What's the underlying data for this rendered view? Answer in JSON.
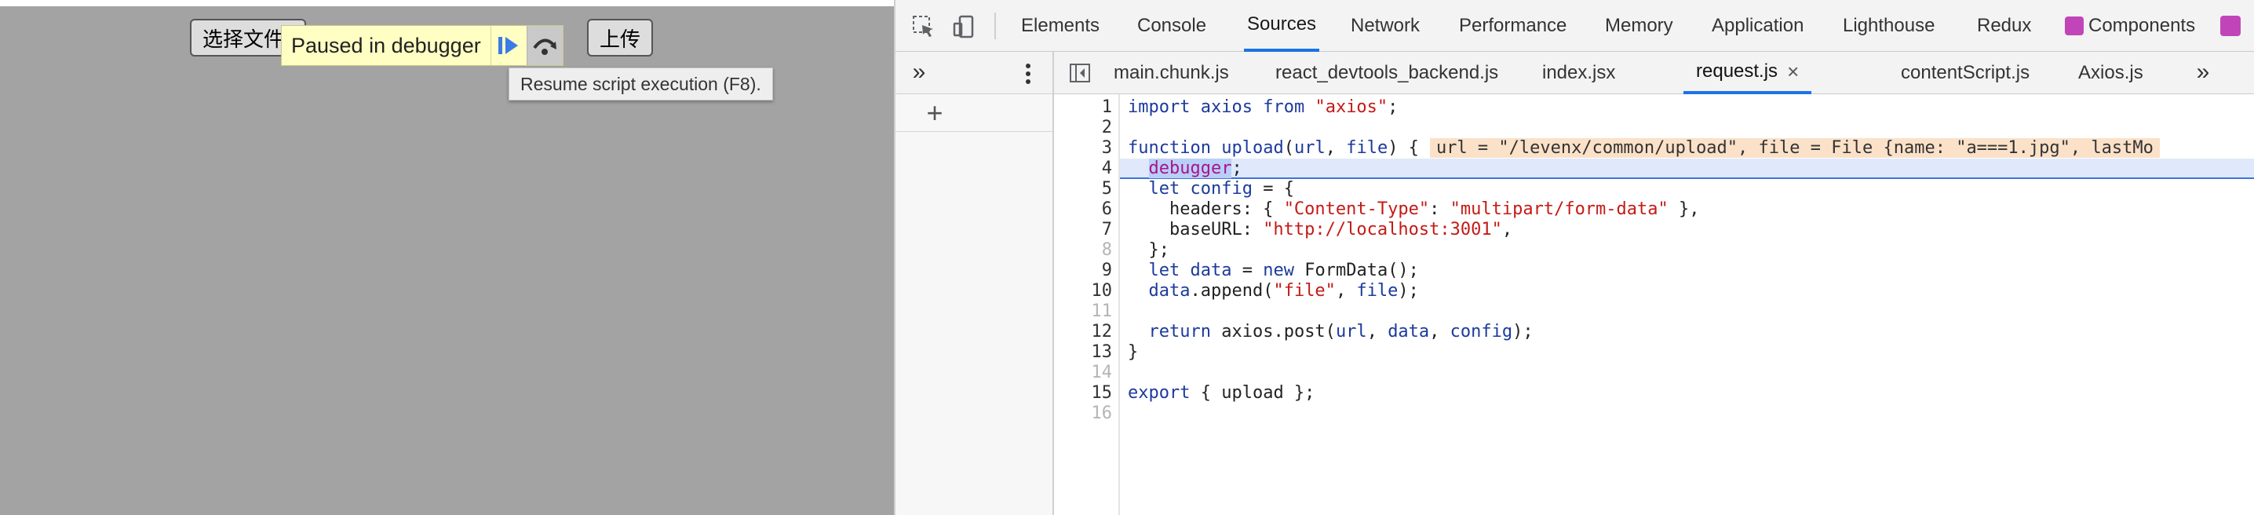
{
  "page": {
    "file_button_label": "选择文件",
    "upload_button_label": "上传",
    "paused_label": "Paused in debugger",
    "tooltip": "Resume script execution (F8)."
  },
  "devtools": {
    "main_tabs": [
      "Elements",
      "Console",
      "Sources",
      "Network",
      "Performance",
      "Memory",
      "Application",
      "Lighthouse",
      "Redux",
      "Components"
    ],
    "active_main_tab": "Sources",
    "file_tabs": [
      "main.chunk.js",
      "react_devtools_backend.js",
      "index.jsx",
      "request.js",
      "contentScript.js",
      "Axios.js"
    ],
    "active_file_tab": "request.js",
    "close_glyph": "×",
    "more_glyph": "»",
    "add_glyph": "+",
    "paused_line": 4,
    "code_lines": [
      {
        "n": "1",
        "tokens": [
          [
            "kw2",
            "import"
          ],
          [
            "plain",
            " "
          ],
          [
            "var",
            "axios"
          ],
          [
            "plain",
            " "
          ],
          [
            "kw2",
            "from"
          ],
          [
            "plain",
            " "
          ],
          [
            "str",
            "\"axios\""
          ],
          [
            "plain",
            ";"
          ]
        ]
      },
      {
        "n": "2",
        "tokens": []
      },
      {
        "n": "3",
        "tokens": [
          [
            "kw2",
            "function"
          ],
          [
            "plain",
            " "
          ],
          [
            "var",
            "upload"
          ],
          [
            "plain",
            "("
          ],
          [
            "var",
            "url"
          ],
          [
            "plain",
            ", "
          ],
          [
            "var",
            "file"
          ],
          [
            "plain",
            ") {"
          ]
        ],
        "inline": "url = \"/levenx/common/upload\", file = File {name: \"a===1.jpg\", lastMo"
      },
      {
        "n": "4",
        "tokens": [
          [
            "plain",
            "  "
          ],
          [
            "kw",
            "debugger"
          ],
          [
            "plain",
            ";"
          ]
        ]
      },
      {
        "n": "5",
        "tokens": [
          [
            "plain",
            "  "
          ],
          [
            "kw2",
            "let"
          ],
          [
            "plain",
            " "
          ],
          [
            "var",
            "config"
          ],
          [
            "plain",
            " = {"
          ]
        ]
      },
      {
        "n": "6",
        "tokens": [
          [
            "plain",
            "    headers: { "
          ],
          [
            "str",
            "\"Content-Type\""
          ],
          [
            "plain",
            ": "
          ],
          [
            "str",
            "\"multipart/form-data\""
          ],
          [
            "plain",
            " },"
          ]
        ]
      },
      {
        "n": "7",
        "tokens": [
          [
            "plain",
            "    baseURL: "
          ],
          [
            "str",
            "\"http://localhost:3001\""
          ],
          [
            "plain",
            ","
          ]
        ]
      },
      {
        "n": "8",
        "tokens": [
          [
            "plain",
            "  };"
          ]
        ]
      },
      {
        "n": "9",
        "tokens": [
          [
            "plain",
            "  "
          ],
          [
            "kw2",
            "let"
          ],
          [
            "plain",
            " "
          ],
          [
            "var",
            "data"
          ],
          [
            "plain",
            " = "
          ],
          [
            "kw2",
            "new"
          ],
          [
            "plain",
            " FormData();"
          ]
        ]
      },
      {
        "n": "10",
        "tokens": [
          [
            "plain",
            "  "
          ],
          [
            "var",
            "data"
          ],
          [
            "plain",
            ".append("
          ],
          [
            "str",
            "\"file\""
          ],
          [
            "plain",
            ", "
          ],
          [
            "var",
            "file"
          ],
          [
            "plain",
            ");"
          ]
        ]
      },
      {
        "n": "11",
        "tokens": []
      },
      {
        "n": "12",
        "tokens": [
          [
            "plain",
            "  "
          ],
          [
            "kw2",
            "return"
          ],
          [
            "plain",
            " axios.post("
          ],
          [
            "var",
            "url"
          ],
          [
            "plain",
            ", "
          ],
          [
            "var",
            "data"
          ],
          [
            "plain",
            ", "
          ],
          [
            "var",
            "config"
          ],
          [
            "plain",
            ");"
          ]
        ]
      },
      {
        "n": "13",
        "tokens": [
          [
            "plain",
            "}"
          ]
        ]
      },
      {
        "n": "14",
        "tokens": []
      },
      {
        "n": "15",
        "tokens": [
          [
            "kw2",
            "export"
          ],
          [
            "plain",
            " { upload };"
          ]
        ]
      },
      {
        "n": "16",
        "tokens": []
      }
    ]
  },
  "colors": {
    "accent": "#1a73e8",
    "paused_bg": "#ffffc4",
    "exec_line": "#dfe9fb",
    "inline_values_bg": "#fbe1c8"
  }
}
